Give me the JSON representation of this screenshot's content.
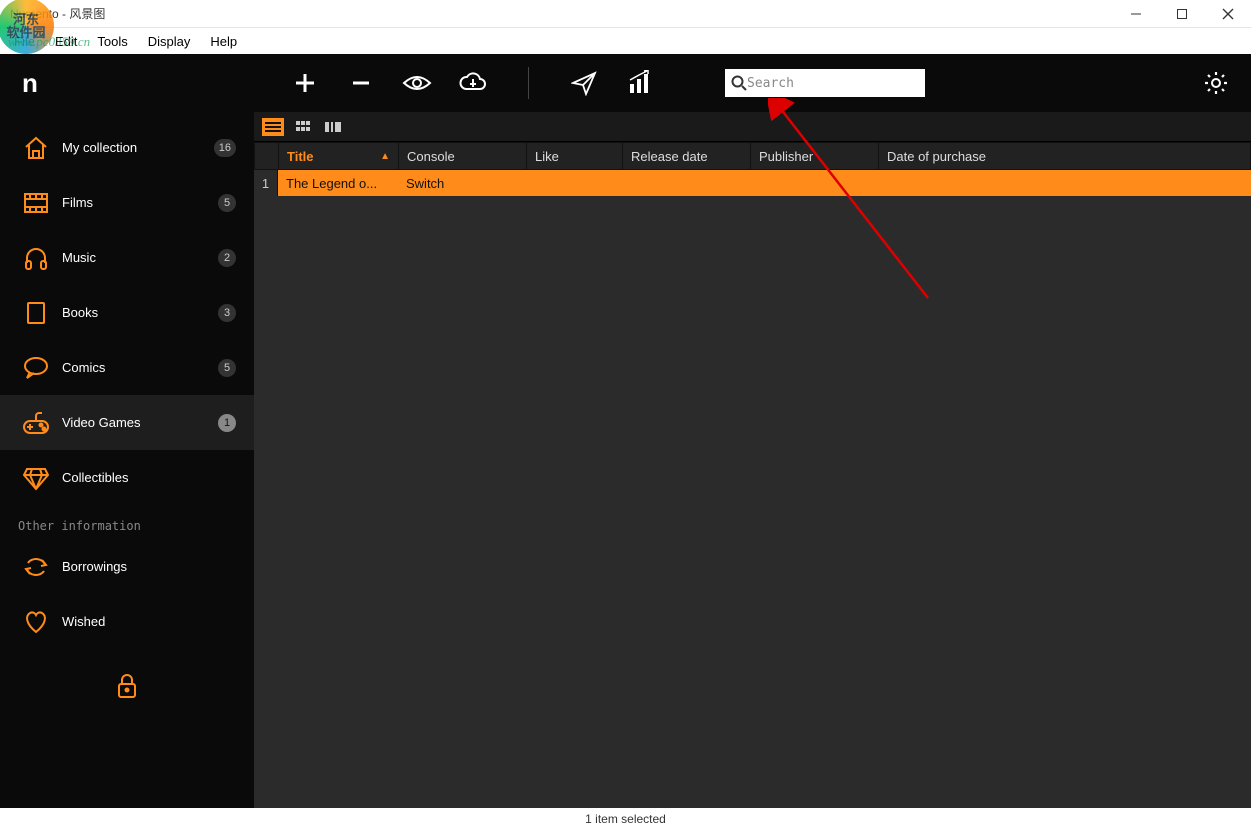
{
  "window": {
    "title": "Numento - 风景图"
  },
  "menu": [
    "File",
    "Edit",
    "Tools",
    "Display",
    "Help"
  ],
  "search": {
    "placeholder": "Search"
  },
  "sidebar": {
    "items": [
      {
        "label": "My collection",
        "count": "16",
        "icon": "home"
      },
      {
        "label": "Films",
        "count": "5",
        "icon": "film"
      },
      {
        "label": "Music",
        "count": "2",
        "icon": "headphones"
      },
      {
        "label": "Books",
        "count": "3",
        "icon": "book"
      },
      {
        "label": "Comics",
        "count": "5",
        "icon": "chat"
      },
      {
        "label": "Video Games",
        "count": "1",
        "icon": "gamepad",
        "active": true
      },
      {
        "label": "Collectibles",
        "count": "",
        "icon": "diamond"
      }
    ],
    "section": "Other information",
    "other": [
      {
        "label": "Borrowings",
        "icon": "refresh"
      },
      {
        "label": "Wished",
        "icon": "heart"
      }
    ]
  },
  "columns": {
    "title": "Title",
    "console": "Console",
    "like": "Like",
    "release": "Release date",
    "publisher": "Publisher",
    "dop": "Date of purchase"
  },
  "rows": [
    {
      "idx": "1",
      "title": "The Legend o...",
      "console": "Switch"
    }
  ],
  "status": "1 item selected",
  "watermark": {
    "text": "河东\n软件园",
    "url": "www.pc0359.cn"
  }
}
